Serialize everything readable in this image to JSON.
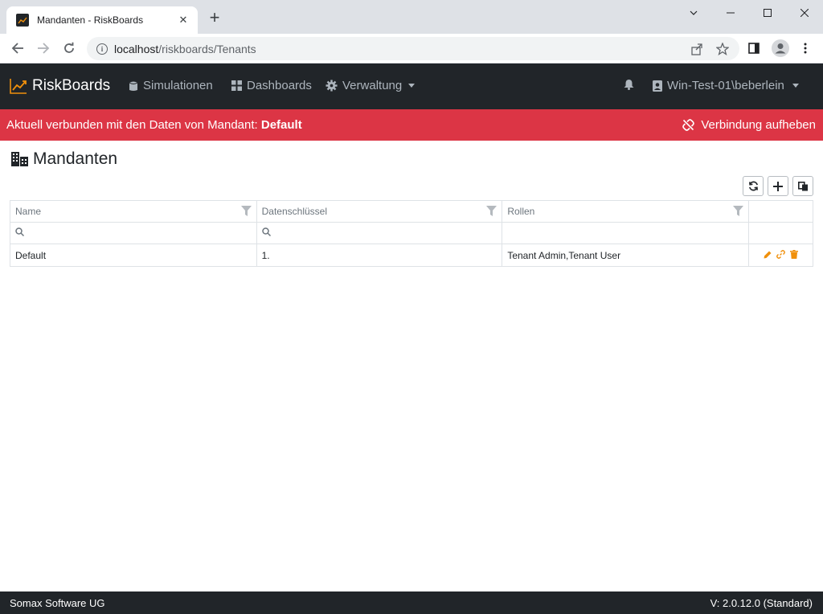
{
  "browser": {
    "tab_title": "Mandanten - RiskBoards",
    "url_host": "localhost",
    "url_path": "/riskboards/Tenants"
  },
  "navbar": {
    "brand": "RiskBoards",
    "items": [
      {
        "label": "Simulationen",
        "icon": "file-icon"
      },
      {
        "label": "Dashboards",
        "icon": "grid-icon"
      },
      {
        "label": "Verwaltung",
        "icon": "gear-icon"
      }
    ],
    "user": "Win-Test-01\\beberlein"
  },
  "alert": {
    "prefix": "Aktuell verbunden mit den Daten von Mandant: ",
    "tenant": "Default",
    "action": "Verbindung aufheben"
  },
  "page": {
    "title": "Mandanten"
  },
  "grid": {
    "columns": [
      "Name",
      "Datenschlüssel",
      "Rollen"
    ],
    "rows": [
      {
        "name": "Default",
        "key": "1.",
        "roles": "Tenant Admin,Tenant User"
      }
    ]
  },
  "footer": {
    "company": "Somax Software UG",
    "version": "V: 2.0.12.0 (Standard)"
  },
  "colors": {
    "navbar_bg": "#212529",
    "alert_bg": "#dc3545",
    "accent_orange": "#f0900c"
  }
}
